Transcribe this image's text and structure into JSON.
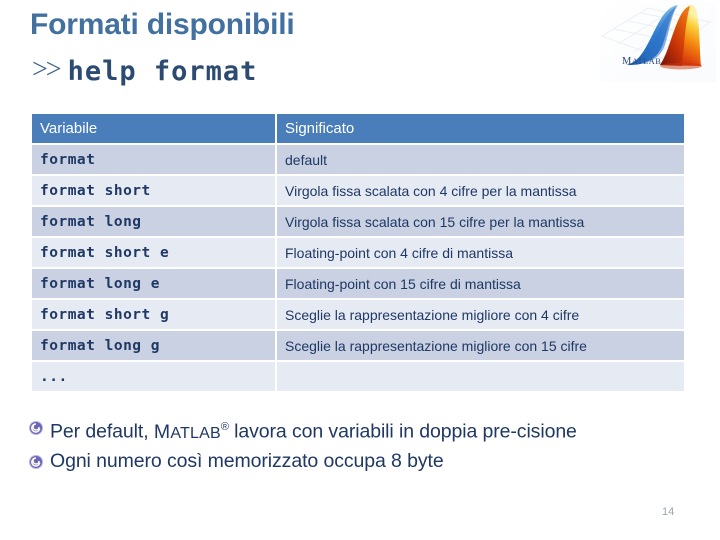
{
  "slide": {
    "title": "Formati disponibili",
    "prompt": {
      "chevrons": ">>",
      "command": "help format"
    },
    "page_number": "14",
    "colors": {
      "title": "#4271A0",
      "table_header_bg": "#4A7EBB",
      "row_odd_bg": "#C9D1E3",
      "row_even_bg": "#E6EAF3",
      "body_text": "#1F3864"
    }
  },
  "logo": {
    "name": "matlab-logo",
    "wordmark": "MATLAB"
  },
  "table": {
    "headers": [
      "Variabile",
      "Significato"
    ],
    "rows": [
      {
        "variabile": "format",
        "significato": "default"
      },
      {
        "variabile": "format short",
        "significato": "Virgola fissa scalata con 4 cifre per la mantissa"
      },
      {
        "variabile": "format long",
        "significato": "Virgola fissa scalata con 15 cifre per la mantissa"
      },
      {
        "variabile": "format short e",
        "significato": "Floating-point con 4 cifre di mantissa"
      },
      {
        "variabile": "format long e",
        "significato": "Floating-point con 15 cifre di mantissa"
      },
      {
        "variabile": "format short g",
        "significato": "Sceglie la rappresentazione migliore con 4 cifre"
      },
      {
        "variabile": "format long g",
        "significato": "Sceglie la rappresentazione migliore con 15 cifre"
      },
      {
        "variabile": "...",
        "significato": ""
      }
    ]
  },
  "bullets": [
    {
      "icon": "spiral-bullet-icon",
      "prefix": "Per default, ",
      "brand_cap": "M",
      "brand_rest": "ATLAB",
      "brand_reg": "®",
      "suffix": " lavora con variabili in doppia pre-cisione"
    },
    {
      "icon": "spiral-bullet-icon",
      "prefix": "Ogni numero così memorizzato occupa 8 byte",
      "brand_cap": "",
      "brand_rest": "",
      "brand_reg": "",
      "suffix": ""
    }
  ]
}
